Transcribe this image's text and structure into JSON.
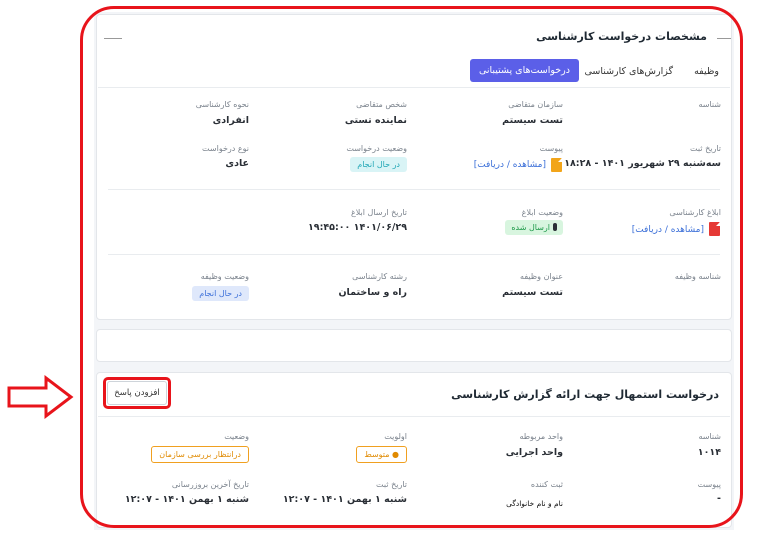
{
  "section1": {
    "title": "مشخصات درخواست کارشناسی",
    "tabs": [
      {
        "label": "وظیفه"
      },
      {
        "label": "گزارش‌های کارشناسی"
      },
      {
        "label": "درخواست‌های پشتیبانی"
      }
    ],
    "fields": {
      "id_label": "شناسه",
      "org_label": "سازمان متقاضی",
      "org_value": "تست سیستم",
      "applicant_label": "شخص متقاضی",
      "applicant_value": "نماینده تستی",
      "method_label": "نحوه کارشناسی",
      "method_value": "انفرادی",
      "reg_date_label": "تاریخ ثبت",
      "reg_date_value": "سه‌شنبه ۲۹ شهریور ۱۴۰۱ - ۱۸:۲۸",
      "attach_label": "پیوست",
      "attach_link": "[مشاهده / دریافت]",
      "req_status_label": "وضعیت درخواست",
      "req_status_value": "در حال انجام",
      "req_type_label": "نوع درخواست",
      "req_type_value": "عادی",
      "notice_label": "ابلاغ کارشناسی",
      "notice_link": "[مشاهده / دریافت]",
      "notice_status_label": "وضعیت ابلاغ",
      "notice_status_value": "ارسال شده",
      "notice_date_label": "تاریخ ارسال ابلاغ",
      "notice_date_value": "۱۴۰۱/۰۶/۲۹ ۱۹:۴۵:۰۰",
      "task_id_label": "شناسه وظیفه",
      "task_title_label": "عنوان وظیفه",
      "task_title_value": "تست سیستم",
      "field_label": "رشته کارشناسی",
      "field_value": "راه و ساختمان",
      "task_status_label": "وضعیت وظیفه",
      "task_status_value": "در حال انجام"
    }
  },
  "section2": {
    "title": "درخواست استمهال جهت ارائه گزارش کارشناسی",
    "add_reply_label": "افزودن پاسخ",
    "fields": {
      "id_label": "شناسه",
      "id_value": "۱۰۱۴",
      "unit_label": "واحد مربوطه",
      "unit_value": "واحد اجرایی",
      "priority_label": "اولویت",
      "priority_value": "● متوسط",
      "status_label": "وضعیت",
      "status_value": "درانتظار بررسی سازمان",
      "attach_label": "پیوست",
      "attach_value": "-",
      "registrar_label": "ثبت کننده",
      "registrar_value": "نام و نام خانوادگی",
      "reg_date_label": "تاریخ ثبت",
      "reg_date_value": "شنبه ۱ بهمن ۱۴۰۱ - ۱۲:۰۷",
      "update_label": "تاریخ آخرین بروزرسانی",
      "update_value": "شنبه ۱ بهمن ۱۴۰۱ - ۱۲:۰۷"
    }
  },
  "colors": {
    "annotation_red": "#e8141b",
    "tab_active": "#5b5fe8",
    "link": "#3b6fd8"
  }
}
